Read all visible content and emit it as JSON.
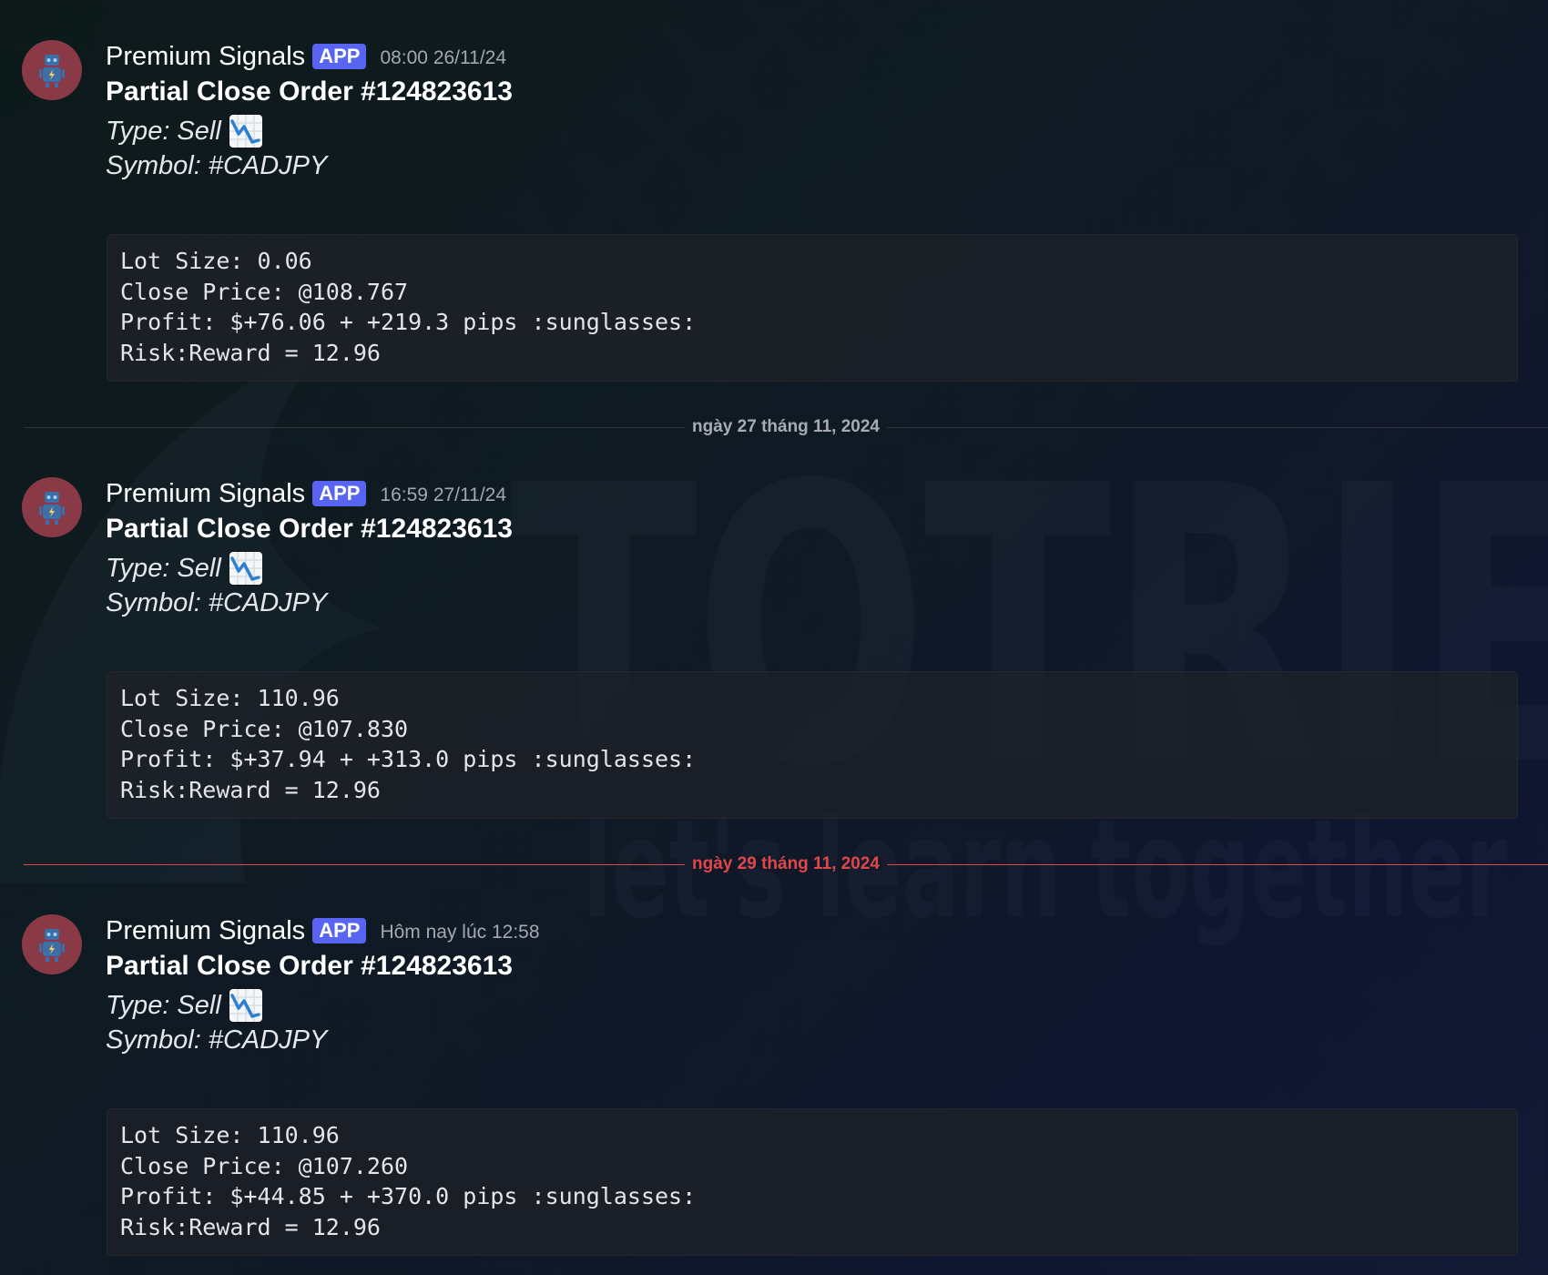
{
  "watermark": {
    "main": "TOTRIE",
    "sub": "let's learn together"
  },
  "messages": [
    {
      "author": "Premium Signals",
      "badge": "APP",
      "timestamp": "08:00 26/11/24",
      "title": "Partial Close Order #124823613",
      "type_line": "Type: Sell",
      "symbol_line": "Symbol: #CADJPY",
      "code": {
        "lot_size": "Lot Size: 0.06",
        "close_price": "Close Price: @108.767",
        "profit": "Profit: $+76.06 + +219.3 pips :sunglasses:",
        "risk_reward": "Risk:Reward = 12.96"
      }
    },
    {
      "author": "Premium Signals",
      "badge": "APP",
      "timestamp": "16:59 27/11/24",
      "title": "Partial Close Order #124823613",
      "type_line": "Type: Sell",
      "symbol_line": "Symbol: #CADJPY",
      "code": {
        "lot_size": "Lot Size: 110.96",
        "close_price": "Close Price: @107.830",
        "profit": "Profit: $+37.94 + +313.0 pips :sunglasses:",
        "risk_reward": "Risk:Reward = 12.96"
      }
    },
    {
      "author": "Premium Signals",
      "badge": "APP",
      "timestamp": "Hôm nay lúc 12:58",
      "title": "Partial Close Order #124823613",
      "type_line": "Type: Sell",
      "symbol_line": "Symbol: #CADJPY",
      "code": {
        "lot_size": "Lot Size: 110.96",
        "close_price": "Close Price: @107.260",
        "profit": "Profit: $+44.85 + +370.0 pips :sunglasses:",
        "risk_reward": "Risk:Reward = 12.96"
      }
    }
  ],
  "dividers": [
    {
      "label": "ngày 27 tháng 11, 2024",
      "color": "#a8abb2"
    },
    {
      "label": "ngày 29 tháng 11, 2024",
      "color": "#e0474d"
    }
  ],
  "colors": {
    "badge": "#5865f2",
    "avatar": "#8a3a47",
    "new_divider": "#e0474d"
  }
}
